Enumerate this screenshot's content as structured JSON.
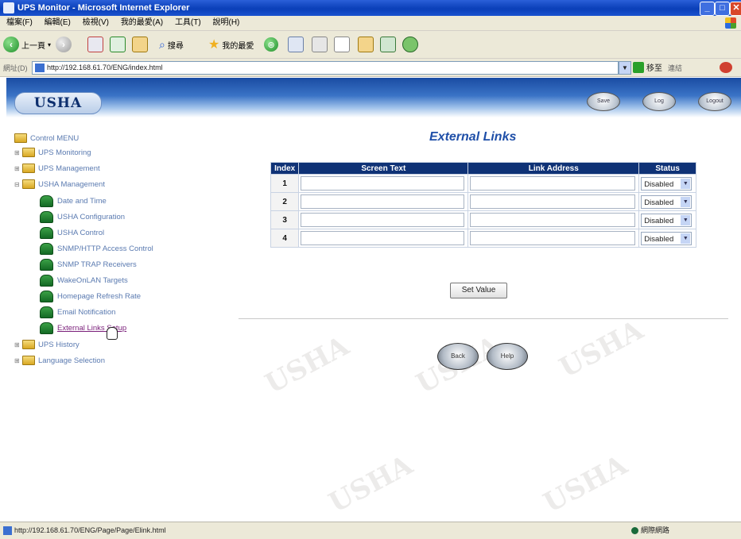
{
  "window": {
    "title": "UPS Monitor - Microsoft Internet Explorer"
  },
  "menu": [
    "檔案(F)",
    "編輯(E)",
    "檢視(V)",
    "我的最愛(A)",
    "工具(T)",
    "說明(H)"
  ],
  "toolbar": {
    "back_label": "上一頁",
    "search_label": "搜尋",
    "favorites_label": "我的最愛"
  },
  "address": {
    "label": "網址(D)",
    "url": "http://192.168.61.70/ENG/index.html",
    "go_label": "移至",
    "links_label": "連結"
  },
  "header": {
    "logo": "USHA",
    "buttons": [
      "Save",
      "Log",
      "Logout"
    ]
  },
  "sidebar": {
    "root": "Control MENU",
    "groups": {
      "ups_monitoring": "UPS Monitoring",
      "ups_management": "UPS Management",
      "usha_management": "USHA Management",
      "ups_history": "UPS History",
      "language_selection": "Language Selection"
    },
    "items": [
      "Date and Time",
      "USHA Configuration",
      "USHA Control",
      "SNMP/HTTP Access Control",
      "SNMP TRAP Receivers",
      "WakeOnLAN Targets",
      "Homepage Refresh Rate",
      "Email Notification",
      "External Links Setup"
    ]
  },
  "main": {
    "title": "External Links",
    "columns": [
      "Index",
      "Screen Text",
      "Link Address",
      "Status"
    ],
    "rows": [
      {
        "index": "1",
        "screen_text": "",
        "link_address": "",
        "status": "Disabled"
      },
      {
        "index": "2",
        "screen_text": "",
        "link_address": "",
        "status": "Disabled"
      },
      {
        "index": "3",
        "screen_text": "",
        "link_address": "",
        "status": "Disabled"
      },
      {
        "index": "4",
        "screen_text": "",
        "link_address": "",
        "status": "Disabled"
      }
    ],
    "set_value_label": "Set Value",
    "back_label": "Back",
    "help_label": "Help"
  },
  "watermark": "USHA",
  "status": {
    "url": "http://192.168.61.70/ENG/Page/Page/Elink.html",
    "zone": "網際網路"
  }
}
